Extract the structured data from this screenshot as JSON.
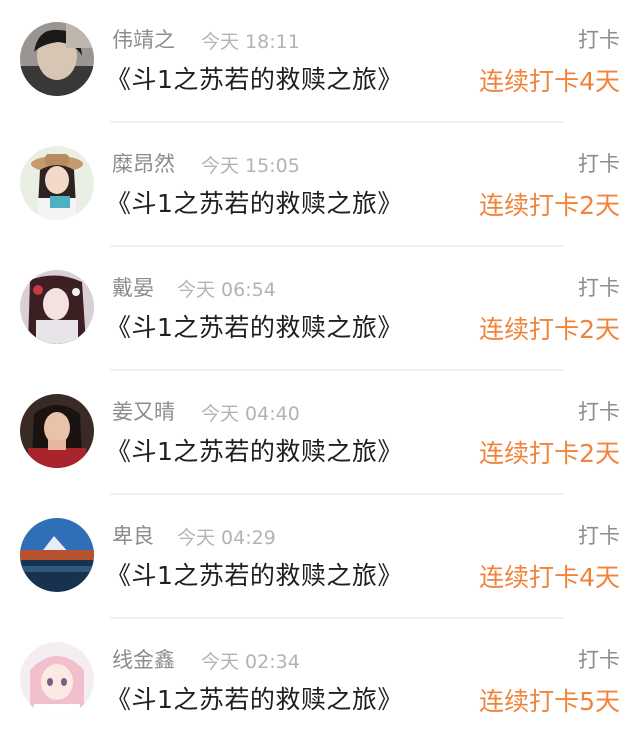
{
  "entries": [
    {
      "name": "伟靖之",
      "time": "今天 18:11",
      "tag": "打卡",
      "book": "《斗1之苏若的救赎之旅》",
      "streak": "连续打卡4天"
    },
    {
      "name": "糜昂然",
      "time": "今天 15:05",
      "tag": "打卡",
      "book": "《斗1之苏若的救赎之旅》",
      "streak": "连续打卡2天"
    },
    {
      "name": "戴晏",
      "time": "今天 06:54",
      "tag": "打卡",
      "book": "《斗1之苏若的救赎之旅》",
      "streak": "连续打卡2天"
    },
    {
      "name": "姜又晴",
      "time": "今天 04:40",
      "tag": "打卡",
      "book": "《斗1之苏若的救赎之旅》",
      "streak": "连续打卡2天"
    },
    {
      "name": "卑良",
      "time": "今天 04:29",
      "tag": "打卡",
      "book": "《斗1之苏若的救赎之旅》",
      "streak": "连续打卡4天"
    },
    {
      "name": "线金鑫",
      "time": "今天 02:34",
      "tag": "打卡",
      "book": "《斗1之苏若的救赎之旅》",
      "streak": "连续打卡5天"
    }
  ],
  "colors": {
    "streak": "#f0843a",
    "name": "#8c8c8c",
    "time": "#b3b3b3",
    "divider": "#f1f1f1"
  },
  "icons": [
    "user-avatar",
    "user-avatar",
    "user-avatar",
    "user-avatar",
    "user-avatar",
    "user-avatar"
  ]
}
